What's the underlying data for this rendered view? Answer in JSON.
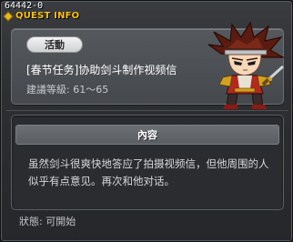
{
  "window": {
    "quest_id": "64442-0",
    "title": "QUEST INFO"
  },
  "header": {
    "category": "活動",
    "quest_name": "[春节任务]协助剑斗制作视频信",
    "level_label": "建議等級:",
    "level_range": "61～65"
  },
  "content": {
    "section_title": "內容",
    "description": "虽然剑斗很爽快地答应了拍摄视频信，但他周围的人似乎有点意见。再次和他对话。"
  },
  "status": {
    "label": "狀態:",
    "value": "可開始"
  },
  "npc": {
    "icon": "npc-warrior-portrait"
  },
  "colors": {
    "title_gold": "#f4c21a",
    "panel_bg": "#4a4d51",
    "content_bg": "#2a2c2f"
  }
}
